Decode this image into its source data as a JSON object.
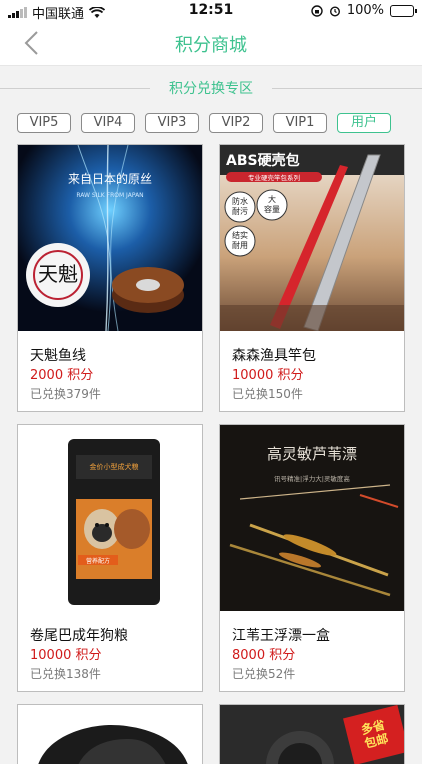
{
  "status": {
    "carrier": "中国联通",
    "time": "12:51",
    "battery": "100%",
    "battery_level": 1.0
  },
  "nav": {
    "title": "积分商城",
    "back_icon": "chevron-left-icon"
  },
  "section": {
    "title": "积分兑换专区"
  },
  "tabs": [
    {
      "label": "VIP5",
      "active": false
    },
    {
      "label": "VIP4",
      "active": false
    },
    {
      "label": "VIP3",
      "active": false
    },
    {
      "label": "VIP2",
      "active": false
    },
    {
      "label": "VIP1",
      "active": false
    },
    {
      "label": "用户",
      "active": true
    }
  ],
  "products": [
    {
      "name": "天魁鱼线",
      "points": "2000 积分",
      "sold": "已兑换379件",
      "image_text": "来自日本的原丝",
      "image_subtext": "RAW SILK FROM JAPAN",
      "image_brand": "天魁"
    },
    {
      "name": "森森渔具竿包",
      "points": "10000 积分",
      "sold": "已兑换150件",
      "image_text": "ABS硬壳包",
      "image_subtext": "专业硬壳竿包系列",
      "badges": [
        "防水耐污",
        "大容量",
        "结实耐用"
      ]
    },
    {
      "name": "卷尾巴成年狗粮",
      "points": "10000 积分",
      "sold": "已兑换138件"
    },
    {
      "name": "江苇王浮漂一盒",
      "points": "8000 积分",
      "sold": "已兑换52件",
      "image_text": "高灵敏芦苇漂",
      "image_subtext": "讯号精准|浮力大|灵敏度高"
    }
  ],
  "partial_badge": "多省包邮",
  "colors": {
    "accent": "#3ec28f",
    "price": "#d01b1b"
  }
}
